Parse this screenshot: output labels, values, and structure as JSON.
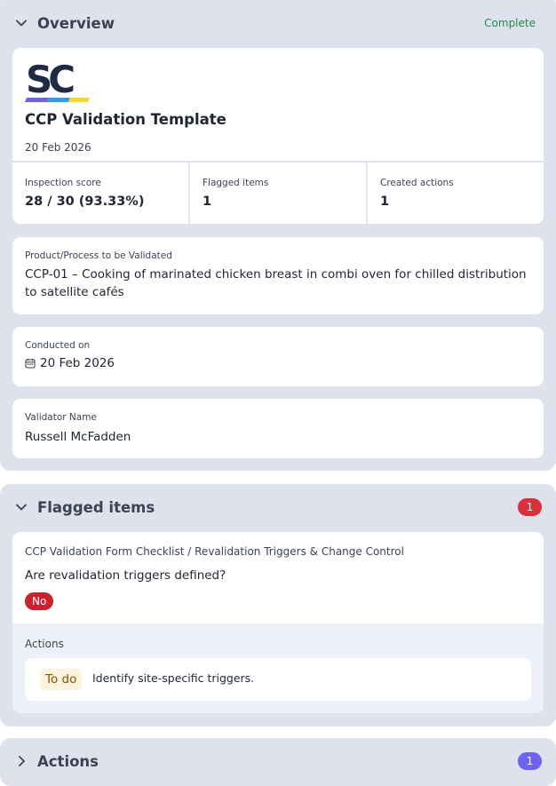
{
  "overview": {
    "title": "Overview",
    "status": "Complete",
    "template_title": "CCP Validation Template",
    "template_date": "20 Feb 2026",
    "logo": "SC",
    "stats": [
      {
        "label": "Inspection score",
        "value": "28 / 30 (93.33%)"
      },
      {
        "label": "Flagged items",
        "value": "1"
      },
      {
        "label": "Created actions",
        "value": "1"
      }
    ],
    "fields": [
      {
        "label": "Product/Process to be Validated",
        "value": "CCP-01 – Cooking of marinated chicken breast in combi oven for chilled distribution to satellite cafés"
      },
      {
        "label": "Conducted on",
        "value": "20 Feb 2026",
        "icon": "calendar-icon"
      },
      {
        "label": "Validator Name",
        "value": "Russell McFadden"
      }
    ]
  },
  "flagged": {
    "title": "Flagged items",
    "count": "1",
    "item": {
      "path": "CCP Validation Form Checklist / Revalidation Triggers & Change Control",
      "question": "Are revalidation triggers defined?",
      "response": "No",
      "actions_label": "Actions",
      "action": {
        "status": "To do",
        "text": "Identify site-specific triggers."
      }
    }
  },
  "actions": {
    "title": "Actions",
    "count": "1"
  },
  "colors": {
    "section_bg": "#dfe2ec",
    "complete": "#1f8a4c",
    "flag_red": "#d7313c",
    "actions_badge": "#6c63f0",
    "todo_bg": "#fdf3dd",
    "todo_text": "#8a5200"
  }
}
